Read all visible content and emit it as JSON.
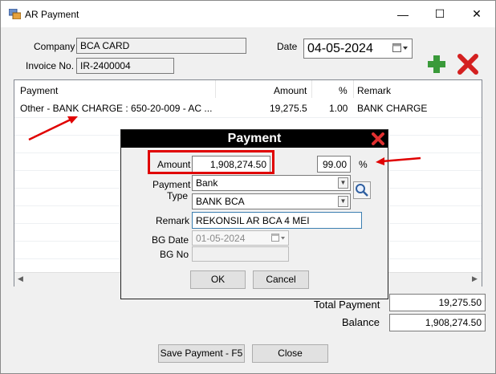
{
  "window": {
    "title": "AR Payment",
    "minimize": "—",
    "maximize": "☐",
    "close": "✕"
  },
  "form": {
    "company_label": "Company",
    "company_value": "BCA CARD",
    "invoice_label": "Invoice No.",
    "invoice_value": "IR-2400004",
    "date_label": "Date",
    "date_value": "04-05-2024"
  },
  "grid": {
    "columns": [
      "Payment",
      "Amount",
      "%",
      "Remark"
    ],
    "rows": [
      {
        "payment": "Other - BANK CHARGE : 650-20-009 - AC ...",
        "amount": "19,275.5",
        "percent": "1.00",
        "remark": "BANK CHARGE"
      }
    ]
  },
  "totals": {
    "total_payment_label": "Total Payment",
    "total_payment_value": "19,275.50",
    "balance_label": "Balance",
    "balance_value": "1,908,274.50"
  },
  "buttons": {
    "save": "Save Payment - F5",
    "close": "Close"
  },
  "dialog": {
    "title": "Payment",
    "amount_label": "Amount",
    "amount_value": "1,908,274.50",
    "percent_value": "99.00",
    "percent_sign": "%",
    "payment_type_label_1": "Payment",
    "payment_type_label_2": "Type",
    "payment_type_value": "Bank",
    "bank_value": "BANK BCA",
    "remark_label": "Remark",
    "remark_value": "REKONSIL AR BCA 4 MEI",
    "bg_date_label": "BG Date",
    "bg_date_value": "01-05-2024",
    "bg_no_label": "BG No",
    "bg_no_value": "",
    "ok": "OK",
    "cancel": "Cancel"
  },
  "colors": {
    "annotation_red": "#e60000",
    "add_green": "#2e8b2e",
    "delete_red": "#d02020"
  },
  "icons": [
    "app-icon",
    "calendar-icon",
    "add-icon",
    "delete-icon",
    "close-icon",
    "search-icon",
    "arrow-annotation"
  ]
}
